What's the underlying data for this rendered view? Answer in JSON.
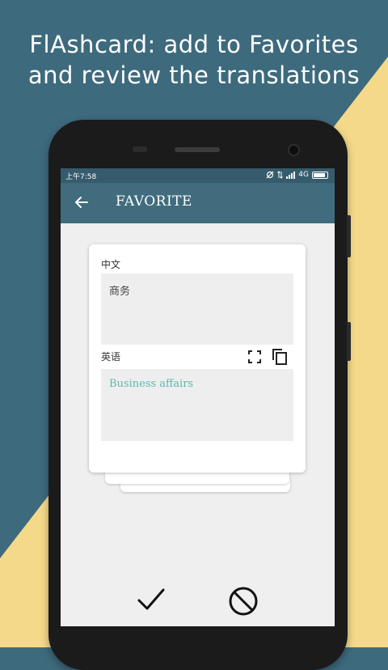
{
  "promo": {
    "headline_line1": "FlAshcard: add to Favorites",
    "headline_line2": "and review the translations"
  },
  "status_bar": {
    "time": "上午7:58",
    "network": "4G"
  },
  "app_bar": {
    "title": "FAVORITE"
  },
  "card": {
    "source_language": "中文",
    "source_text": "商务",
    "target_language": "英语",
    "target_text": "Business affairs"
  },
  "colors": {
    "teal_bg": "#3e6a7d",
    "yellow_bg": "#f5d98a",
    "app_bar": "#406c7e",
    "translation_text": "#5bb8b0"
  },
  "icons": {
    "back": "arrow-left",
    "fullscreen": "fullscreen-corners",
    "copy": "copy-pages",
    "confirm": "checkmark",
    "reject": "no-symbol"
  }
}
